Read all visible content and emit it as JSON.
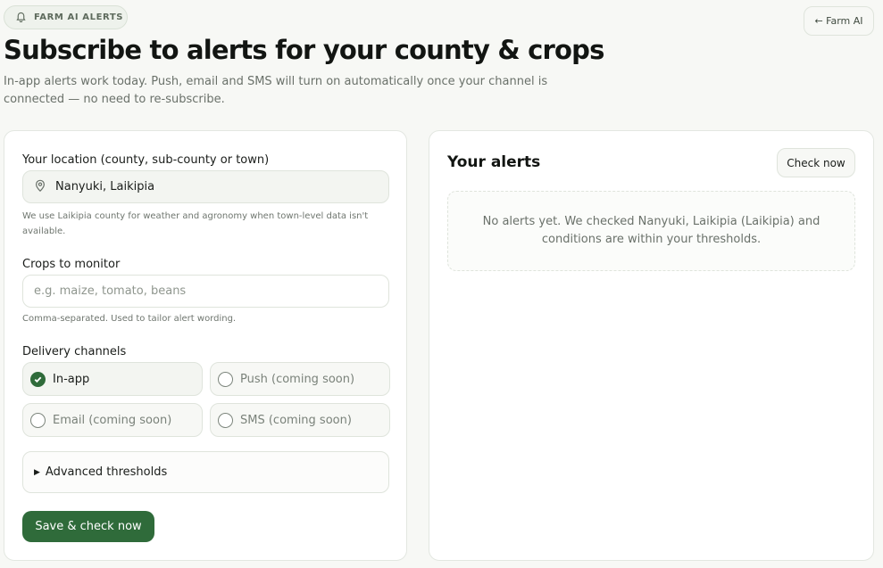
{
  "header": {
    "badge": "FARM AI ALERTS",
    "badge_icon": "bell-icon",
    "back_link": "← Farm AI",
    "title": "Subscribe to alerts for your county & crops",
    "subtitle": "In-app alerts work today. Push, email and SMS will turn on automatically once your channel is connected — no need to re-subscribe."
  },
  "form": {
    "location_label": "Your location (county, sub-county or town)",
    "location_icon": "map-pin-icon",
    "location_value": "Nanyuki, Laikipia",
    "location_help": "We use Laikipia county for weather and agronomy when town-level data isn't available.",
    "crops_label": "Crops to monitor",
    "crops_value": "",
    "crops_placeholder": "e.g. maize, tomato, beans",
    "crops_help": "Comma-separated. Used to tailor alert wording.",
    "channels_label": "Delivery channels",
    "channels": [
      {
        "label": "In-app",
        "checked": true
      },
      {
        "label": "Push (coming soon)",
        "checked": false
      },
      {
        "label": "Email (coming soon)",
        "checked": false
      },
      {
        "label": "SMS (coming soon)",
        "checked": false
      }
    ],
    "advanced_label": "Advanced thresholds",
    "save_label": "Save & check now"
  },
  "alerts": {
    "title": "Your alerts",
    "check_label": "Check now",
    "empty_message": "No alerts yet. We checked Nanyuki, Laikipia (Laikipia) and conditions are within your thresholds."
  },
  "colors": {
    "accent": "#2f6b3a",
    "background": "#f7f8f5"
  }
}
